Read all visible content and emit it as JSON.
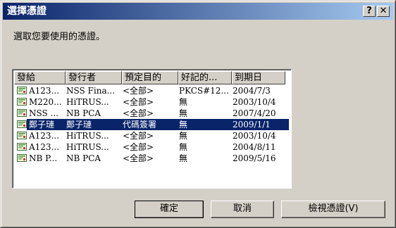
{
  "window": {
    "title": "選擇憑證",
    "help_label": "?",
    "close_label": "✕"
  },
  "prompt": "選取您要使用的憑證。",
  "columns": [
    "發給",
    "發行者",
    "預定目的",
    "好記的...",
    "到期日"
  ],
  "rows": [
    {
      "issued_to": "A123...",
      "issuer": "NSS Fina...",
      "purpose": "<全部>",
      "friendly": "PKCS#12...",
      "expires": "2004/7/3",
      "selected": false
    },
    {
      "issued_to": "M220...",
      "issuer": "HiTRUS...",
      "purpose": "<全部>",
      "friendly": "無",
      "expires": "2003/10/4",
      "selected": false
    },
    {
      "issued_to": "NSS ...",
      "issuer": "NB PCA",
      "purpose": "<全部>",
      "friendly": "無",
      "expires": "2007/4/20",
      "selected": false
    },
    {
      "issued_to": "鄭子璉",
      "issuer": "鄭子璉",
      "purpose": "代碼簽署",
      "friendly": "無",
      "expires": "2009/1/1",
      "selected": true
    },
    {
      "issued_to": "A123...",
      "issuer": "HiTRUS...",
      "purpose": "<全部>",
      "friendly": "無",
      "expires": "2003/10/4",
      "selected": false
    },
    {
      "issued_to": "A123...",
      "issuer": "HiTRUS...",
      "purpose": "<全部>",
      "friendly": "無",
      "expires": "2004/8/11",
      "selected": false
    },
    {
      "issued_to": "NB P...",
      "issuer": "NB PCA",
      "purpose": "<全部>",
      "friendly": "無",
      "expires": "2009/5/16",
      "selected": false
    }
  ],
  "buttons": {
    "ok": "確定",
    "cancel": "取消",
    "view": "檢視憑證(V)"
  },
  "colors": {
    "title_bar": "#0a246a",
    "selection": "#0a246a",
    "window_bg": "#d4d0c8"
  }
}
